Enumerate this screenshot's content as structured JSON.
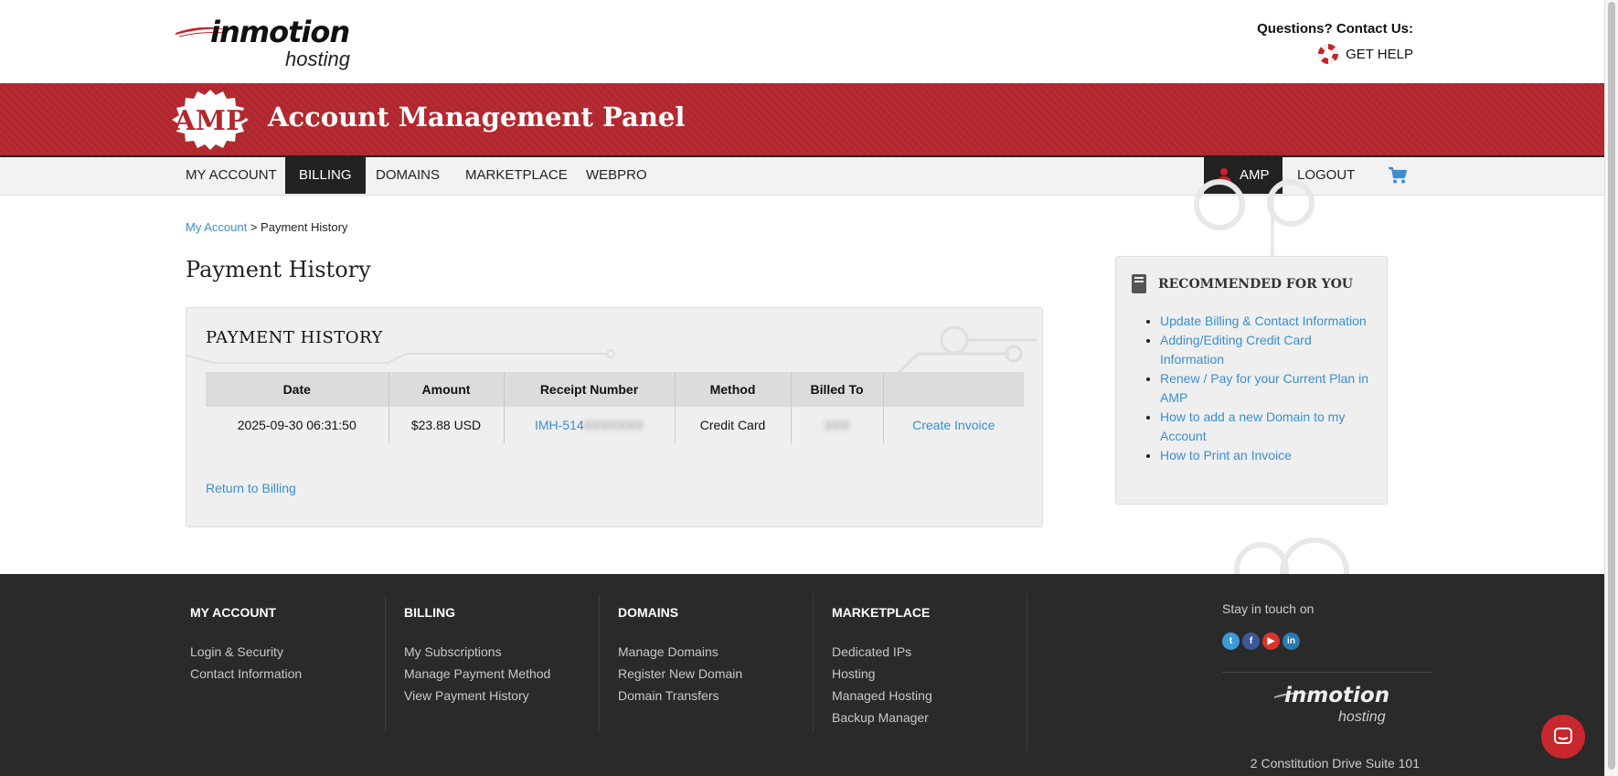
{
  "header": {
    "logo_brand": "inmotion",
    "logo_sub": "hosting",
    "contact_question": "Questions? Contact Us:",
    "get_help": "GET HELP"
  },
  "banner": {
    "badge": "AMP",
    "title": "Account Management Panel"
  },
  "nav": {
    "items": [
      "MY ACCOUNT",
      "BILLING",
      "DOMAINS",
      "MARKETPLACE",
      "WEBPRO"
    ],
    "active": "BILLING",
    "amp_label": "AMP",
    "logout": "LOGOUT"
  },
  "breadcrumb": {
    "parent": "My Account",
    "separator": ">",
    "current": "Payment History"
  },
  "page_title": "Payment History",
  "panel": {
    "title": "PAYMENT HISTORY",
    "columns": [
      "Date",
      "Amount",
      "Receipt Number",
      "Method",
      "Billed To",
      ""
    ],
    "rows": [
      {
        "date": "2025-09-30 06:31:50",
        "amount": "$23.88 USD",
        "receipt_prefix": "IMH-514",
        "receipt_redacted": "XXXXXXX",
        "method": "Credit Card",
        "billed_to": "XXX",
        "action": "Create Invoice"
      }
    ],
    "return_link": "Return to Billing"
  },
  "recommended": {
    "title": "RECOMMENDED FOR YOU",
    "links": [
      "Update Billing & Contact Information",
      "Adding/Editing Credit Card Information",
      "Renew / Pay for your Current Plan in AMP",
      "How to add a new Domain to my Account",
      "How to Print an Invoice"
    ]
  },
  "footer": {
    "columns": [
      {
        "title": "MY ACCOUNT",
        "links": [
          "Login & Security",
          "Contact Information"
        ]
      },
      {
        "title": "BILLING",
        "links": [
          "My Subscriptions",
          "Manage Payment Method",
          "View Payment History"
        ]
      },
      {
        "title": "DOMAINS",
        "links": [
          "Manage Domains",
          "Register New Domain",
          "Domain Transfers"
        ]
      },
      {
        "title": "MARKETPLACE",
        "links": [
          "Dedicated IPs",
          "Hosting",
          "Managed Hosting",
          "Backup Manager"
        ]
      }
    ],
    "stay_in_touch": "Stay in touch on",
    "social_icons": [
      "twitter-icon",
      "facebook-icon",
      "youtube-icon",
      "linkedin-icon"
    ],
    "social_colors": [
      "#3b9ad9",
      "#3b5998",
      "#d9342b",
      "#2a7ab0"
    ],
    "logo_brand": "inmotion",
    "logo_sub": "hosting",
    "address": "2 Constitution Drive Suite 101"
  },
  "colors": {
    "brand_red": "#b2272e",
    "link_blue": "#3a8ed0",
    "footer_bg": "#2a2a2a",
    "nav_active_bg": "#222222"
  }
}
